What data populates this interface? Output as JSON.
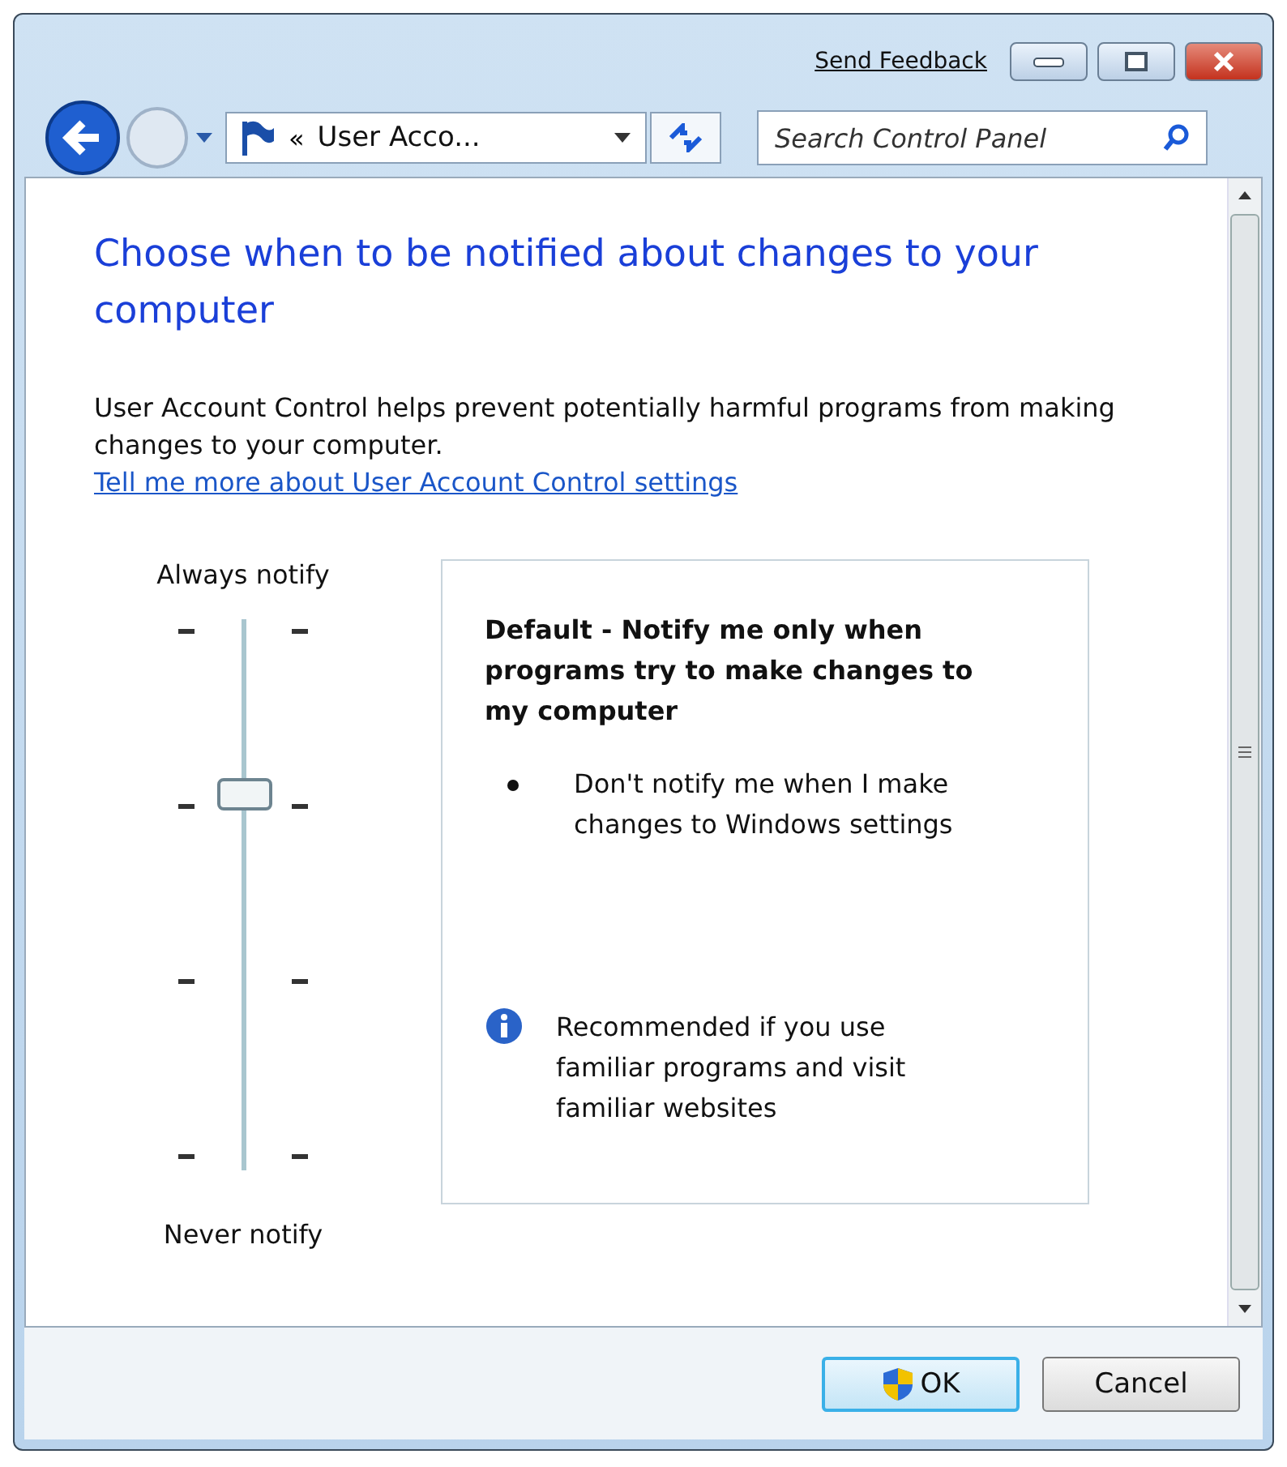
{
  "window": {
    "send_feedback": "Send Feedback"
  },
  "address_bar": {
    "separator": "«",
    "path": "User Acco..."
  },
  "search": {
    "placeholder": "Search Control Panel"
  },
  "heading": "Choose when to be notified about changes to your computer",
  "description": "User Account Control helps prevent potentially harmful programs from making changes to your computer.",
  "link": "Tell me more about User Account Control settings",
  "slider": {
    "top_label": "Always notify",
    "bottom_label": "Never notify",
    "level": 0.67
  },
  "details": {
    "title": "Default - Notify me only when programs try to make changes to my computer",
    "bullets": [
      "Don't notify me when I make changes to Windows settings"
    ],
    "note": "Recommended if you use familiar programs and visit familiar websites"
  },
  "buttons": [
    {
      "label": "OK",
      "kind": "shield",
      "focused": true
    },
    {
      "label": "Cancel",
      "kind": "plain",
      "focused": false
    }
  ]
}
